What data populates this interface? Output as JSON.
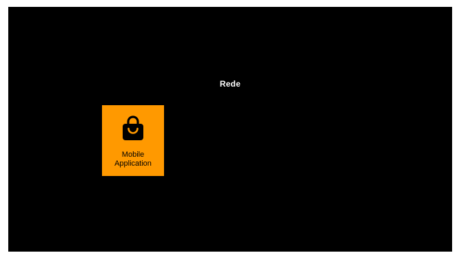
{
  "screen": {
    "title": "Rede",
    "background_color": "#000000"
  },
  "apps": [
    {
      "icon": "shopping-bag-icon",
      "label_line1": "Mobile",
      "label_line2": "Application",
      "tile_color": "#ff9900"
    }
  ]
}
